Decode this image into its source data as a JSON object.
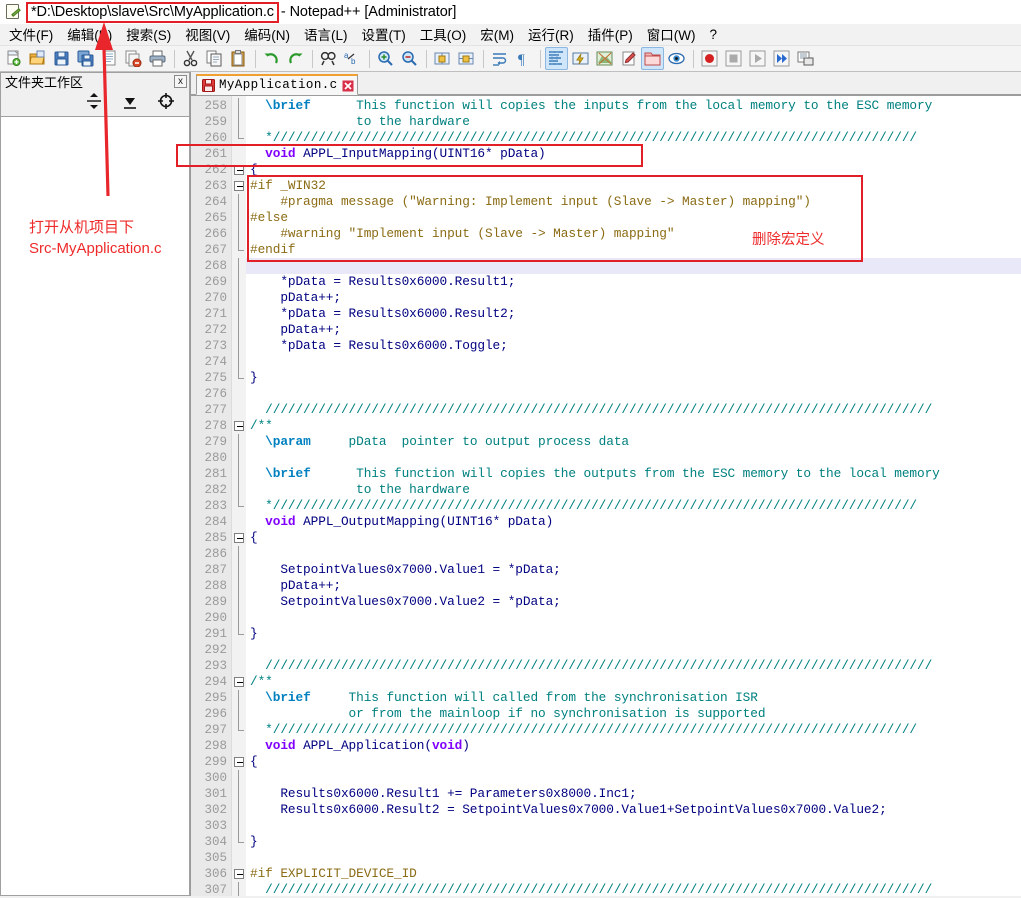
{
  "window": {
    "title_path": "*D:\\Desktop\\slave\\Src\\MyApplication.c",
    "title_suffix": "- Notepad++ [Administrator]"
  },
  "menubar": {
    "items": [
      {
        "label": "文件(F)",
        "name": "menu-file"
      },
      {
        "label": "编辑(E)",
        "name": "menu-edit"
      },
      {
        "label": "搜索(S)",
        "name": "menu-search"
      },
      {
        "label": "视图(V)",
        "name": "menu-view"
      },
      {
        "label": "编码(N)",
        "name": "menu-encoding"
      },
      {
        "label": "语言(L)",
        "name": "menu-language"
      },
      {
        "label": "设置(T)",
        "name": "menu-settings"
      },
      {
        "label": "工具(O)",
        "name": "menu-tools"
      },
      {
        "label": "宏(M)",
        "name": "menu-macro"
      },
      {
        "label": "运行(R)",
        "name": "menu-run"
      },
      {
        "label": "插件(P)",
        "name": "menu-plugins"
      },
      {
        "label": "窗口(W)",
        "name": "menu-window"
      },
      {
        "label": "?",
        "name": "menu-help"
      }
    ]
  },
  "toolbar": {
    "icons": [
      "new-file-icon",
      "open-file-icon",
      "save-icon",
      "save-all-icon",
      "close-file-icon",
      "close-all-icon",
      "print-icon",
      "cut-icon",
      "copy-icon",
      "paste-icon",
      "undo-icon",
      "redo-icon",
      "find-icon",
      "replace-icon",
      "zoom-in-icon",
      "zoom-out-icon",
      "sync-vertical-icon",
      "sync-horizontal-icon",
      "word-wrap-icon",
      "show-all-chars-icon",
      "indent-guide-icon",
      "udl-dialog-icon",
      "document-map-icon",
      "function-list-icon",
      "folder-workspace-icon",
      "monitoring-icon",
      "record-macro-icon",
      "stop-macro-icon",
      "play-macro-icon",
      "play-multiple-icon",
      "save-macro-icon"
    ],
    "active_icons": [
      "indent-guide-icon",
      "folder-workspace-icon"
    ]
  },
  "left_panel": {
    "title": "文件夹工作区",
    "close_label": "x",
    "tool_icons": [
      "expand-all-icon",
      "collapse-all-icon",
      "locate-current-file-icon"
    ],
    "annotation_line1": "打开从机项目下",
    "annotation_line2": "Src-MyApplication.c"
  },
  "tabs": [
    {
      "label": "MyApplication.c",
      "modified": true,
      "active": true
    }
  ],
  "annotations": {
    "macro_note": "删除宏定义",
    "accent_color": "#e21f26",
    "text_color": "#ee2a2a"
  },
  "editor": {
    "first_line": 258,
    "current_line": 268,
    "lines": [
      {
        "n": 258,
        "fold": "bar",
        "tokens": [
          {
            "t": "  ",
            "c": "k-pln"
          },
          {
            "t": "\\brief",
            "c": "k-doc"
          },
          {
            "t": "      This function will copies the inputs from the local memory to the ESC memory",
            "c": "k-cmt"
          }
        ]
      },
      {
        "n": 259,
        "fold": "bar",
        "tokens": [
          {
            "t": "              to the hardware",
            "c": "k-cmt"
          }
        ]
      },
      {
        "n": 260,
        "fold": "end",
        "tokens": [
          {
            "t": "  */////////////////////////////////////////////////////////////////////////////////////",
            "c": "k-cmt"
          }
        ]
      },
      {
        "n": 261,
        "fold": "none",
        "tokens": [
          {
            "t": "  ",
            "c": "k-pln"
          },
          {
            "t": "void",
            "c": "k-kw"
          },
          {
            "t": " APPL_InputMapping(UINT16* pData)",
            "c": "k-pln"
          }
        ]
      },
      {
        "n": 262,
        "fold": "box",
        "tokens": [
          {
            "t": "{",
            "c": "k-pln"
          }
        ]
      },
      {
        "n": 263,
        "fold": "box",
        "tokens": [
          {
            "t": "#if _WIN32",
            "c": "k-pre"
          }
        ]
      },
      {
        "n": 264,
        "fold": "bar",
        "tokens": [
          {
            "t": "    #pragma message (\"Warning: Implement input (Slave -> Master) mapping\")",
            "c": "k-pre"
          }
        ]
      },
      {
        "n": 265,
        "fold": "bar",
        "tokens": [
          {
            "t": "#else",
            "c": "k-pre"
          }
        ]
      },
      {
        "n": 266,
        "fold": "bar",
        "tokens": [
          {
            "t": "    #warning \"Implement input (Slave -> Master) mapping\"",
            "c": "k-pre"
          }
        ]
      },
      {
        "n": 267,
        "fold": "end",
        "tokens": [
          {
            "t": "#endif",
            "c": "k-pre"
          }
        ]
      },
      {
        "n": 268,
        "fold": "bar",
        "tokens": [
          {
            "t": "",
            "c": "k-pln"
          }
        ]
      },
      {
        "n": 269,
        "fold": "bar",
        "tokens": [
          {
            "t": "    *pData = Results0x6000.Result1;",
            "c": "k-pln"
          }
        ]
      },
      {
        "n": 270,
        "fold": "bar",
        "tokens": [
          {
            "t": "    pData++;",
            "c": "k-pln"
          }
        ]
      },
      {
        "n": 271,
        "fold": "bar",
        "tokens": [
          {
            "t": "    *pData = Results0x6000.Result2;",
            "c": "k-pln"
          }
        ]
      },
      {
        "n": 272,
        "fold": "bar",
        "tokens": [
          {
            "t": "    pData++;",
            "c": "k-pln"
          }
        ]
      },
      {
        "n": 273,
        "fold": "bar",
        "tokens": [
          {
            "t": "    *pData = Results0x6000.Toggle;",
            "c": "k-pln"
          }
        ]
      },
      {
        "n": 274,
        "fold": "bar",
        "tokens": [
          {
            "t": "",
            "c": "k-pln"
          }
        ]
      },
      {
        "n": 275,
        "fold": "end",
        "tokens": [
          {
            "t": "}",
            "c": "k-pln"
          }
        ]
      },
      {
        "n": 276,
        "fold": "none",
        "tokens": [
          {
            "t": "",
            "c": "k-pln"
          }
        ]
      },
      {
        "n": 277,
        "fold": "none",
        "tokens": [
          {
            "t": "  ////////////////////////////////////////////////////////////////////////////////////////",
            "c": "k-cmt"
          }
        ]
      },
      {
        "n": 278,
        "fold": "box",
        "tokens": [
          {
            "t": "/**",
            "c": "k-cmt"
          }
        ]
      },
      {
        "n": 279,
        "fold": "bar",
        "tokens": [
          {
            "t": "  ",
            "c": "k-pln"
          },
          {
            "t": "\\param",
            "c": "k-doc"
          },
          {
            "t": "     pData  pointer to output process data",
            "c": "k-cmt"
          }
        ]
      },
      {
        "n": 280,
        "fold": "bar",
        "tokens": [
          {
            "t": "",
            "c": "k-pln"
          }
        ]
      },
      {
        "n": 281,
        "fold": "bar",
        "tokens": [
          {
            "t": "  ",
            "c": "k-pln"
          },
          {
            "t": "\\brief",
            "c": "k-doc"
          },
          {
            "t": "      This function will copies the outputs from the ESC memory to the local memory",
            "c": "k-cmt"
          }
        ]
      },
      {
        "n": 282,
        "fold": "bar",
        "tokens": [
          {
            "t": "              to the hardware",
            "c": "k-cmt"
          }
        ]
      },
      {
        "n": 283,
        "fold": "end",
        "tokens": [
          {
            "t": "  */////////////////////////////////////////////////////////////////////////////////////",
            "c": "k-cmt"
          }
        ]
      },
      {
        "n": 284,
        "fold": "none",
        "tokens": [
          {
            "t": "  ",
            "c": "k-pln"
          },
          {
            "t": "void",
            "c": "k-kw"
          },
          {
            "t": " APPL_OutputMapping(UINT16* pData)",
            "c": "k-pln"
          }
        ]
      },
      {
        "n": 285,
        "fold": "box",
        "tokens": [
          {
            "t": "{",
            "c": "k-pln"
          }
        ]
      },
      {
        "n": 286,
        "fold": "bar",
        "tokens": [
          {
            "t": "",
            "c": "k-pln"
          }
        ]
      },
      {
        "n": 287,
        "fold": "bar",
        "tokens": [
          {
            "t": "    SetpointValues0x7000.Value1 = *pData;",
            "c": "k-pln"
          }
        ]
      },
      {
        "n": 288,
        "fold": "bar",
        "tokens": [
          {
            "t": "    pData++;",
            "c": "k-pln"
          }
        ]
      },
      {
        "n": 289,
        "fold": "bar",
        "tokens": [
          {
            "t": "    SetpointValues0x7000.Value2 = *pData;",
            "c": "k-pln"
          }
        ]
      },
      {
        "n": 290,
        "fold": "bar",
        "tokens": [
          {
            "t": "",
            "c": "k-pln"
          }
        ]
      },
      {
        "n": 291,
        "fold": "end",
        "tokens": [
          {
            "t": "}",
            "c": "k-pln"
          }
        ]
      },
      {
        "n": 292,
        "fold": "none",
        "tokens": [
          {
            "t": "",
            "c": "k-pln"
          }
        ]
      },
      {
        "n": 293,
        "fold": "none",
        "tokens": [
          {
            "t": "  ////////////////////////////////////////////////////////////////////////////////////////",
            "c": "k-cmt"
          }
        ]
      },
      {
        "n": 294,
        "fold": "box",
        "tokens": [
          {
            "t": "/**",
            "c": "k-cmt"
          }
        ]
      },
      {
        "n": 295,
        "fold": "bar",
        "tokens": [
          {
            "t": "  ",
            "c": "k-pln"
          },
          {
            "t": "\\brief",
            "c": "k-doc"
          },
          {
            "t": "     This function will called from the synchronisation ISR",
            "c": "k-cmt"
          }
        ]
      },
      {
        "n": 296,
        "fold": "bar",
        "tokens": [
          {
            "t": "             or from the mainloop if no synchronisation is supported",
            "c": "k-cmt"
          }
        ]
      },
      {
        "n": 297,
        "fold": "end",
        "tokens": [
          {
            "t": "  */////////////////////////////////////////////////////////////////////////////////////",
            "c": "k-cmt"
          }
        ]
      },
      {
        "n": 298,
        "fold": "none",
        "tokens": [
          {
            "t": "  ",
            "c": "k-pln"
          },
          {
            "t": "void",
            "c": "k-kw"
          },
          {
            "t": " APPL_Application(",
            "c": "k-pln"
          },
          {
            "t": "void",
            "c": "k-kw"
          },
          {
            "t": ")",
            "c": "k-pln"
          }
        ]
      },
      {
        "n": 299,
        "fold": "box",
        "tokens": [
          {
            "t": "{",
            "c": "k-pln"
          }
        ]
      },
      {
        "n": 300,
        "fold": "bar",
        "tokens": [
          {
            "t": "",
            "c": "k-pln"
          }
        ]
      },
      {
        "n": 301,
        "fold": "bar",
        "tokens": [
          {
            "t": "    Results0x6000.Result1 += Parameters0x8000.Inc1;",
            "c": "k-pln"
          }
        ]
      },
      {
        "n": 302,
        "fold": "bar",
        "tokens": [
          {
            "t": "    Results0x6000.Result2 = SetpointValues0x7000.Value1+SetpointValues0x7000.Value2;",
            "c": "k-pln"
          }
        ]
      },
      {
        "n": 303,
        "fold": "bar",
        "tokens": [
          {
            "t": "",
            "c": "k-pln"
          }
        ]
      },
      {
        "n": 304,
        "fold": "end",
        "tokens": [
          {
            "t": "}",
            "c": "k-pln"
          }
        ]
      },
      {
        "n": 305,
        "fold": "none",
        "tokens": [
          {
            "t": "",
            "c": "k-pln"
          }
        ]
      },
      {
        "n": 306,
        "fold": "box",
        "tokens": [
          {
            "t": "#if EXPLICIT_DEVICE_ID",
            "c": "k-pre"
          }
        ]
      },
      {
        "n": 307,
        "fold": "bar",
        "tokens": [
          {
            "t": "  ////////////////////////////////////////////////////////////////////////////////////////",
            "c": "k-cmt"
          }
        ]
      }
    ]
  }
}
